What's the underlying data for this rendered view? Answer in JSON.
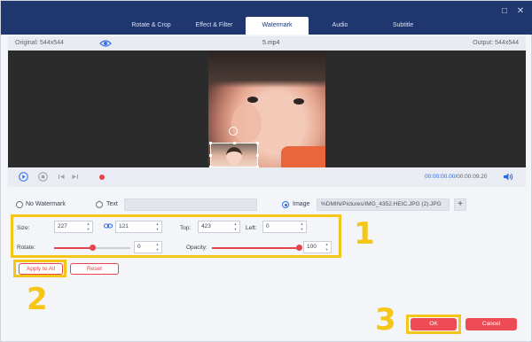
{
  "tabs": [
    {
      "label": "Rotate & Crop"
    },
    {
      "label": "Effect & Filter"
    },
    {
      "label": "Watermark"
    },
    {
      "label": "Audio"
    },
    {
      "label": "Subtitle"
    }
  ],
  "active_tab": "Watermark",
  "info": {
    "original": "Original: 544x544",
    "filename": "5.mp4",
    "output": "Output: 544x544"
  },
  "playback": {
    "current": "00:00:00.00",
    "total": "/00:00:09.20",
    "progress": 0.0
  },
  "watermark": {
    "no_watermark_label": "No Watermark",
    "text_label": "Text",
    "text_value": "",
    "image_label": "Image",
    "image_path": "%DMIN/Pictures/IMG_4352.HEIC.JPG (2).JPG",
    "add_button": "+",
    "selected": "Image"
  },
  "params": {
    "size_label": "Size:",
    "width": "227",
    "height": "121",
    "top_label": "Top:",
    "top": "423",
    "left_label": "Left:",
    "left": "0",
    "rotate_label": "Rotate:",
    "rotate": "0",
    "rotate_fraction": 0.5,
    "opacity_label": "Opacity:",
    "opacity": "100",
    "opacity_fraction": 1.0
  },
  "buttons": {
    "apply_all": "Apply to All",
    "reset": "Reset",
    "ok": "OK",
    "cancel": "Cancel"
  },
  "annotations": {
    "one": "1",
    "two": "2",
    "three": "3",
    "color": "#f5c518"
  },
  "colors": {
    "accent": "#e8424c",
    "header": "#20366f",
    "link": "#2e6be6"
  }
}
